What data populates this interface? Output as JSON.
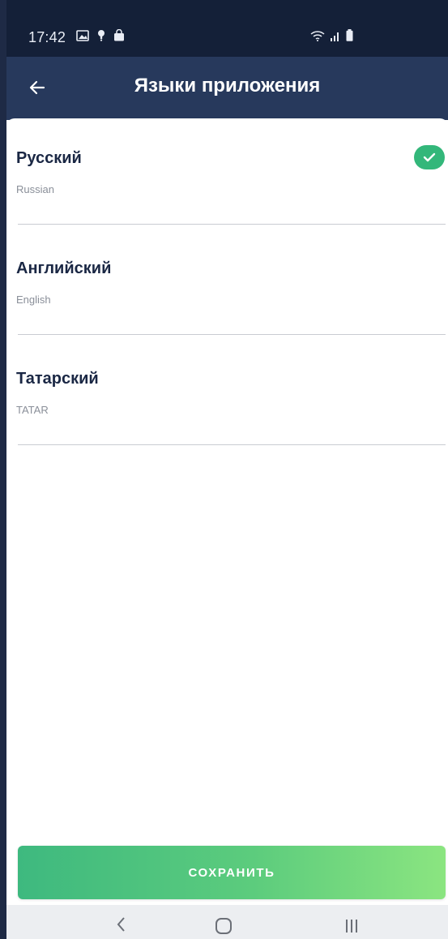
{
  "status_bar": {
    "time": "17:42",
    "left_icons": [
      "image-icon",
      "location-pin-icon",
      "shopping-bag-icon"
    ],
    "right_icons": [
      "wifi-icon",
      "signal-icon",
      "battery-icon"
    ]
  },
  "app_bar": {
    "title": "Языки приложения",
    "back_icon": "arrow-left-icon"
  },
  "languages": [
    {
      "name": "Русский",
      "subtitle": "Russian",
      "selected": true
    },
    {
      "name": "Английский",
      "subtitle": "English",
      "selected": false
    },
    {
      "name": "Татарский",
      "subtitle": "TATAR",
      "selected": false
    }
  ],
  "save_button": {
    "label": "СОХРАНИТЬ"
  },
  "colors": {
    "status_bar": "#142038",
    "app_bar": "#27395c",
    "title_text": "#1a2744",
    "check": "#33b77a",
    "button_gradient_start": "#3eb97f",
    "button_gradient_end": "#8be580"
  },
  "nav_bar": {
    "icons": [
      "back-nav-icon",
      "home-nav-icon",
      "recents-nav-icon"
    ]
  }
}
